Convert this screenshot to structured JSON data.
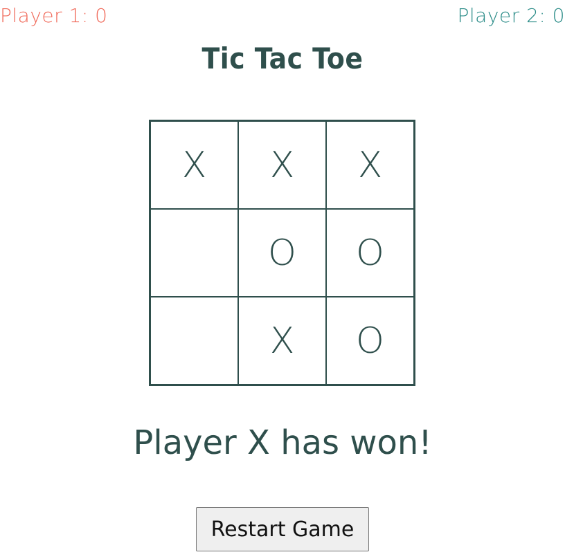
{
  "scores": {
    "player1": "Player 1: 0",
    "player2": "Player 2: 0"
  },
  "title": "Tic Tac Toe",
  "board": {
    "cells": [
      "X",
      "X",
      "X",
      "",
      "O",
      "O",
      "",
      "X",
      "O"
    ]
  },
  "status": "Player X has won!",
  "restart_label": "Restart Game",
  "colors": {
    "player1": "#f06a5a",
    "player2": "#2b8c88",
    "ink": "#2f4f4c"
  }
}
